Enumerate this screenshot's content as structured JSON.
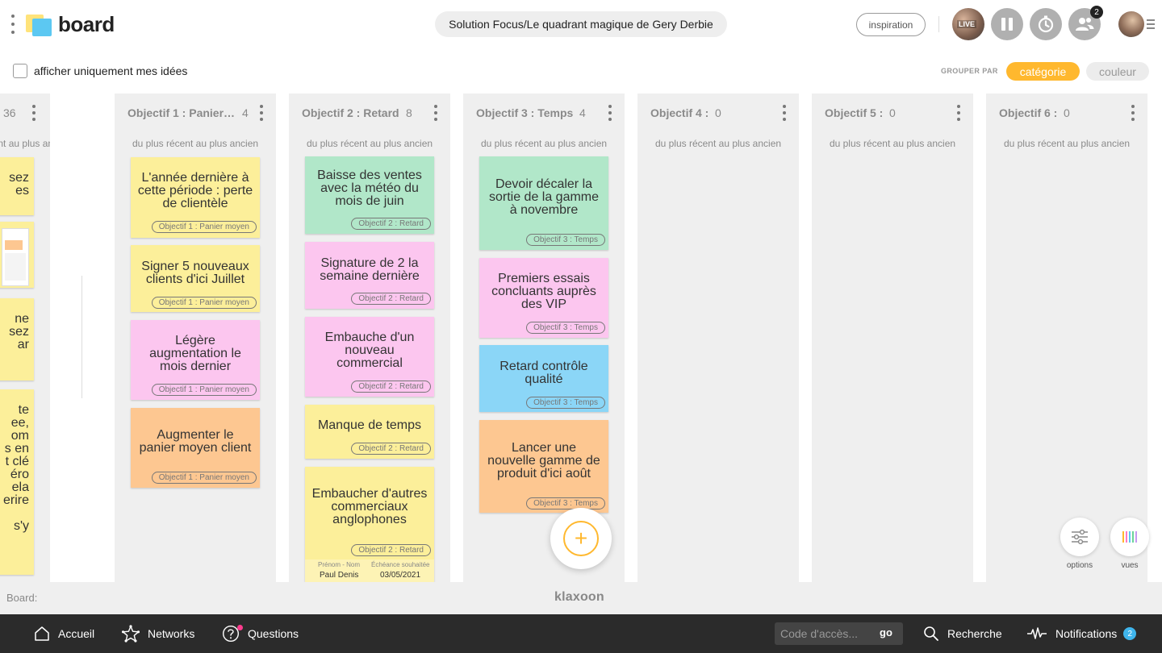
{
  "app": {
    "logo_text": "board"
  },
  "header": {
    "board_title": "Solution Focus/Le quadrant magique de Gery Derbie",
    "inspiration_label": "inspiration",
    "live_label": "LIVE",
    "participants_count": "2"
  },
  "filters": {
    "only_mine_label": "afficher uniquement mes idées",
    "only_mine_checked": false,
    "group_by_label": "GROUPER PAR",
    "group_options": [
      "catégorie",
      "couleur"
    ],
    "group_selected": "catégorie"
  },
  "partial_column": {
    "count": "36",
    "sort_label": "du plus récent au plus ancien",
    "cards": [
      {
        "text": "sez\nes"
      },
      {
        "text": ""
      },
      {
        "text": "ne\nsez\nar"
      },
      {
        "text": "te\nee,\nom\ns en\nt clé\néro\nela\nerire\n\ns'y"
      }
    ]
  },
  "columns": [
    {
      "title": "Objectif 1 : Panier…",
      "count": "4",
      "sort_label": "du plus récent au plus ancien",
      "cards": [
        {
          "text": "L'année dernière à cette période : perte de clientèle",
          "color": "yellow",
          "tag": "Objectif 1 : Panier moyen"
        },
        {
          "text": "Signer 5 nouveaux clients d'ici Juillet",
          "color": "yellow",
          "tag": "Objectif 1 : Panier moyen"
        },
        {
          "text": "Légère augmentation le mois dernier",
          "color": "pink",
          "tag": "Objectif 1 : Panier moyen"
        },
        {
          "text": "Augmenter le panier moyen client",
          "color": "orange",
          "tag": "Objectif 1 : Panier moyen"
        }
      ]
    },
    {
      "title": "Objectif 2 : Retard",
      "count": "8",
      "sort_label": "du plus récent au plus ancien",
      "cards": [
        {
          "text": "Baisse des ventes avec la météo du mois de juin",
          "color": "green",
          "tag": "Objectif 2 : Retard"
        },
        {
          "text": "Signature de 2 la semaine dernière",
          "color": "pink",
          "tag": "Objectif 2 : Retard"
        },
        {
          "text": "Embauche d'un nouveau commercial",
          "color": "pink",
          "tag": "Objectif 2 : Retard"
        },
        {
          "text": "Manque de temps",
          "color": "yellow",
          "tag": "Objectif 2 : Retard"
        },
        {
          "text": "Embaucher d'autres commerciaux anglophones",
          "color": "yellow",
          "tag": "Objectif 2 : Retard",
          "meta": {
            "name_label": "Prénom - Nom",
            "name_value": "Paul Denis",
            "date_label": "Échéance souhaitée",
            "date_value": "03/05/2021"
          }
        }
      ]
    },
    {
      "title": "Objectif 3 : Temps",
      "count": "4",
      "sort_label": "du plus récent au plus ancien",
      "cards": [
        {
          "text": "Devoir décaler la sortie de la gamme à novembre",
          "color": "green",
          "tag": "Objectif 3 : Temps"
        },
        {
          "text": "Premiers essais concluants auprès des VIP",
          "color": "pink",
          "tag": "Objectif 3 : Temps"
        },
        {
          "text": "Retard contrôle qualité",
          "color": "blue",
          "tag": "Objectif 3 : Temps"
        },
        {
          "text": "Lancer une nouvelle gamme de produit d'ici août",
          "color": "orange",
          "tag": "Objectif 3 : Temps"
        }
      ]
    },
    {
      "title": "Objectif 4 :",
      "count": "0",
      "sort_label": "du plus récent au plus ancien",
      "cards": []
    },
    {
      "title": "Objectif 5 :",
      "count": "0",
      "sort_label": "du plus récent au plus ancien",
      "cards": []
    },
    {
      "title": "Objectif 6 :",
      "count": "0",
      "sort_label": "du plus récent au plus ancien",
      "cards": []
    }
  ],
  "side_buttons": {
    "options_label": "options",
    "views_label": "vues"
  },
  "footer": {
    "board_label": "Board:",
    "brand": "klaxoon"
  },
  "nav": {
    "home": "Accueil",
    "networks": "Networks",
    "questions": "Questions",
    "access_code_placeholder": "Code d'accès...",
    "go": "go",
    "search": "Recherche",
    "notifications": "Notifications",
    "notifications_count": "2"
  }
}
